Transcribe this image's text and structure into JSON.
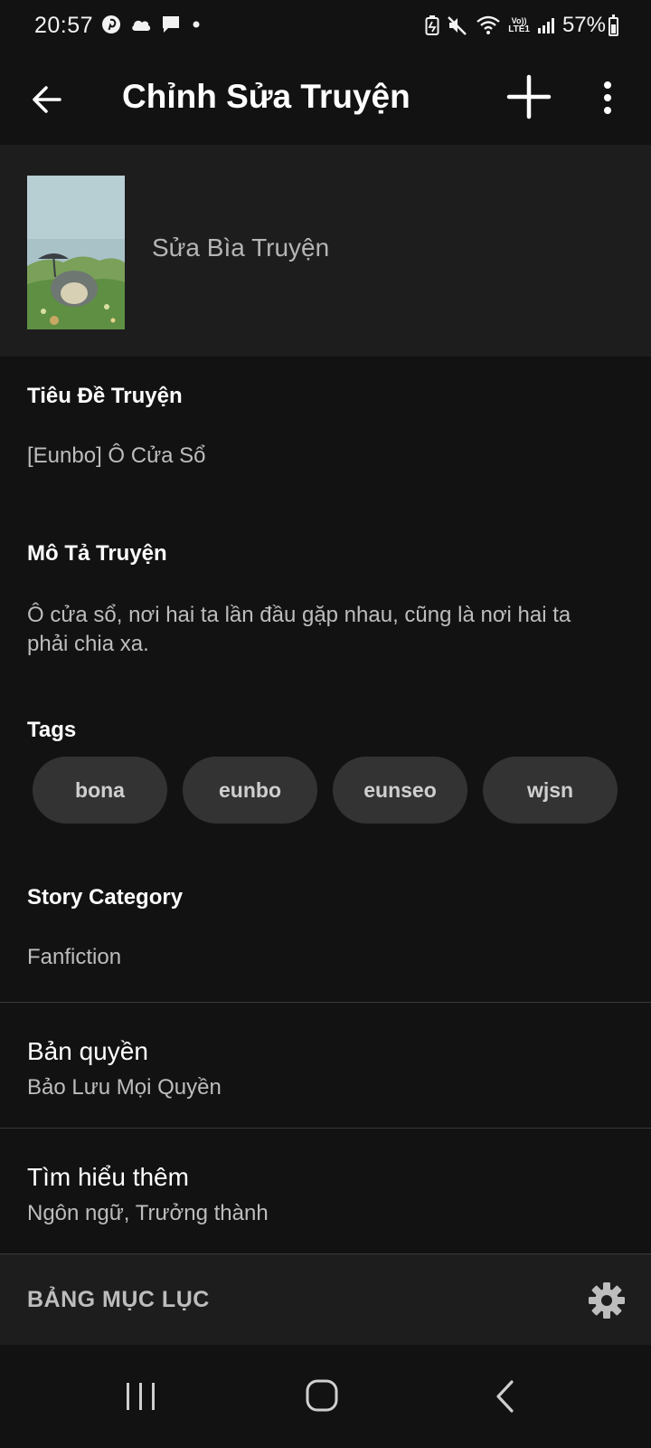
{
  "status": {
    "time": "20:57",
    "battery": "57%",
    "battery_level": 0.57,
    "network": "LTE1",
    "left_icons": [
      "pinterest-icon",
      "cloud-icon",
      "message-icon",
      "dot-icon"
    ],
    "right_icons": [
      "battery-saver-icon",
      "mute-icon",
      "wifi-icon",
      "volte-icon",
      "signal-icon"
    ]
  },
  "app_bar": {
    "title": "Chỉnh Sửa Truyện",
    "icons": [
      "back-arrow-icon",
      "plus-icon",
      "more-vertical-icon"
    ]
  },
  "cover": {
    "label": "Sửa Bìa Truyện"
  },
  "story": {
    "title_label": "Tiêu Đề Truyện",
    "title_value": "[Eunbo] Ô Cửa Sổ",
    "description_label": "Mô Tả Truyện",
    "description_value": "Ô cửa sổ, nơi hai ta lần đầu gặp nhau, cũng là nơi hai ta phải chia xa.",
    "tags_label": "Tags",
    "tags": [
      "bona",
      "eunbo",
      "eunseo",
      "wjsn"
    ],
    "category_label": "Story Category",
    "category_value": "Fanfiction"
  },
  "copyright": {
    "title": "Bản quyền",
    "subtitle": "Bảo Lưu Mọi Quyền"
  },
  "learn_more": {
    "title": "Tìm hiểu thêm",
    "subtitle": "Ngôn ngữ, Trưởng thành"
  },
  "toc": {
    "label": "BẢNG MỤC LỤC",
    "icon": "gear-icon"
  },
  "nav": {
    "icons": [
      "recent-apps-icon",
      "home-icon",
      "back-icon"
    ]
  },
  "colors": {
    "background": "#121212",
    "surface": "#1d1d1d",
    "tag_bg": "#333333",
    "text_primary": "#ffffff",
    "text_secondary": "#bdbdbd"
  }
}
